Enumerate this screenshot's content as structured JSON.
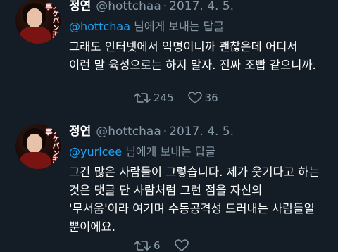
{
  "tweets": [
    {
      "display_name": "정연",
      "handle": "@hottchaa",
      "separator": "·",
      "date": "2017. 4. 5.",
      "reply_to_handle": "@hottchaa",
      "reply_to_suffix": " 님에게 보내는 답글",
      "text": "그래도 인터넷에서 익명이니까 괜찮은데 어디서 이런 말 육성으로는 하지 말자. 진짜 조빱 같으니까.",
      "retweets": "245",
      "likes": "36",
      "avatar_text": "スケバン刑事"
    },
    {
      "display_name": "정연",
      "handle": "@hottchaa",
      "separator": "·",
      "date": "2017. 4. 5.",
      "reply_to_handle": "@yuricee",
      "reply_to_suffix": " 님에게 보내는 답글",
      "text": "그건 많은 사람들이 그렇습니다. 제가 웃기다고 하는 것은 댓글 단 사람처럼 그런 점을 자신의 '무서움'이라 여기며 수동공격성 드러내는 사람들일 뿐이에요.",
      "retweets": "6",
      "likes": "",
      "avatar_text": "スケバン刑事"
    }
  ],
  "icons": {
    "retweet": "retweet-icon",
    "like": "heart-icon"
  },
  "colors": {
    "background": "#141d26",
    "secondary_text": "#8899a6",
    "link": "#1da1f2",
    "divider": "#38444d"
  }
}
